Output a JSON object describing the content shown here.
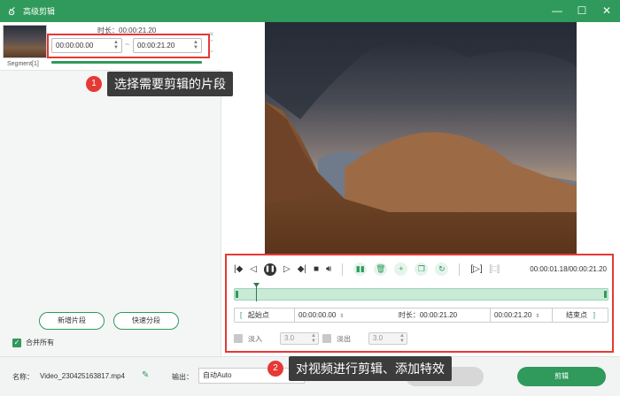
{
  "window": {
    "title": "高级剪辑",
    "controls": [
      "minimize-icon",
      "maximize-icon",
      "close-icon"
    ]
  },
  "segment": {
    "label": "Segment[1]",
    "duration": "时长：00:00:21.20",
    "start": "00:00:00.00",
    "separator": "~",
    "end": "00:00:21.20"
  },
  "left": {
    "add_segment": "新增片段",
    "quick_split": "快速分段",
    "merge_all": "合并所有"
  },
  "controls": {
    "current_time": "00:00:01.18/00:00:21.20",
    "start_point": "起始点",
    "start_value": "00:00:00.00",
    "duration": "时长：00:00:21.20",
    "end_value": "00:00:21.20",
    "end_point": "结束点",
    "fade_in": "淡入",
    "fade_in_value": "3.0",
    "fade_out": "淡出",
    "fade_out_value": "3.0",
    "playback_position": 0.056
  },
  "bottom": {
    "name_label": "名称：",
    "name_value": "Video_230425163817.mp4",
    "output_label": "输出：",
    "output_value": "自动Auto",
    "back": "返回",
    "cut": "剪辑"
  },
  "callouts": [
    {
      "num": "1",
      "text": "选择需要剪辑的片段"
    },
    {
      "num": "2",
      "text": "对视频进行剪辑、添加特效"
    }
  ],
  "colors": {
    "accent": "#2f9a5b",
    "highlight": "#e53935"
  }
}
